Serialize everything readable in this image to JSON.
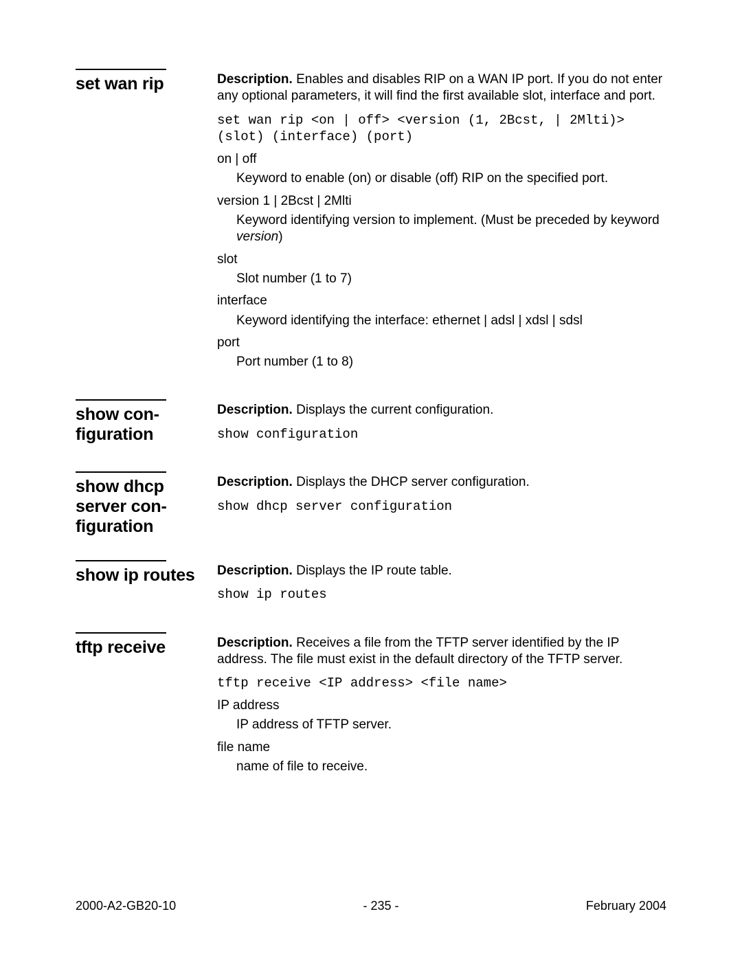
{
  "labels": {
    "description": "Description."
  },
  "entries": [
    {
      "name": "set wan rip",
      "desc": "Enables and disables RIP on a WAN IP port. If you do not enter any optional parameters, it will find the first available slot, interface and port.",
      "syntax": "set wan rip <on | off> <version (1, 2Bcst, | 2Mlti)> (slot) (interface) (port)",
      "params": [
        {
          "term": "on | off",
          "def": "Keyword to enable (on) or disable (off) RIP on the specified port."
        },
        {
          "term": "version 1 | 2Bcst | 2Mlti",
          "def_pre": "Keyword identifying version to implement. (Must be preceded by keyword ",
          "def_italic": "version",
          "def_post": ")"
        },
        {
          "term": "slot",
          "def": "Slot number (1 to 7)"
        },
        {
          "term": "interface",
          "def": "Keyword identifying the interface: ethernet | adsl | xdsl | sdsl"
        },
        {
          "term": "port",
          "def": "Port number (1 to 8)"
        }
      ]
    },
    {
      "name": "show con-figuration",
      "desc": "Displays the current configuration.",
      "syntax": "show configuration"
    },
    {
      "name": "show dhcp server con-figuration",
      "desc": "Displays the DHCP server configuration.",
      "syntax": "show dhcp server configuration"
    },
    {
      "name": "show ip routes",
      "desc": "Displays the IP route table.",
      "syntax": "show ip routes"
    },
    {
      "name": "tftp receive",
      "desc": "Receives a file from the TFTP server identified by the IP address. The file must exist in the default directory of the TFTP server.",
      "syntax": "tftp receive <IP address> <file name>",
      "params": [
        {
          "term": "IP address",
          "def": "IP address of TFTP server."
        },
        {
          "term": "file name",
          "def": "name of file to receive."
        }
      ]
    }
  ],
  "footer": {
    "left": "2000-A2-GB20-10",
    "center": "- 235 -",
    "right": "February 2004"
  }
}
